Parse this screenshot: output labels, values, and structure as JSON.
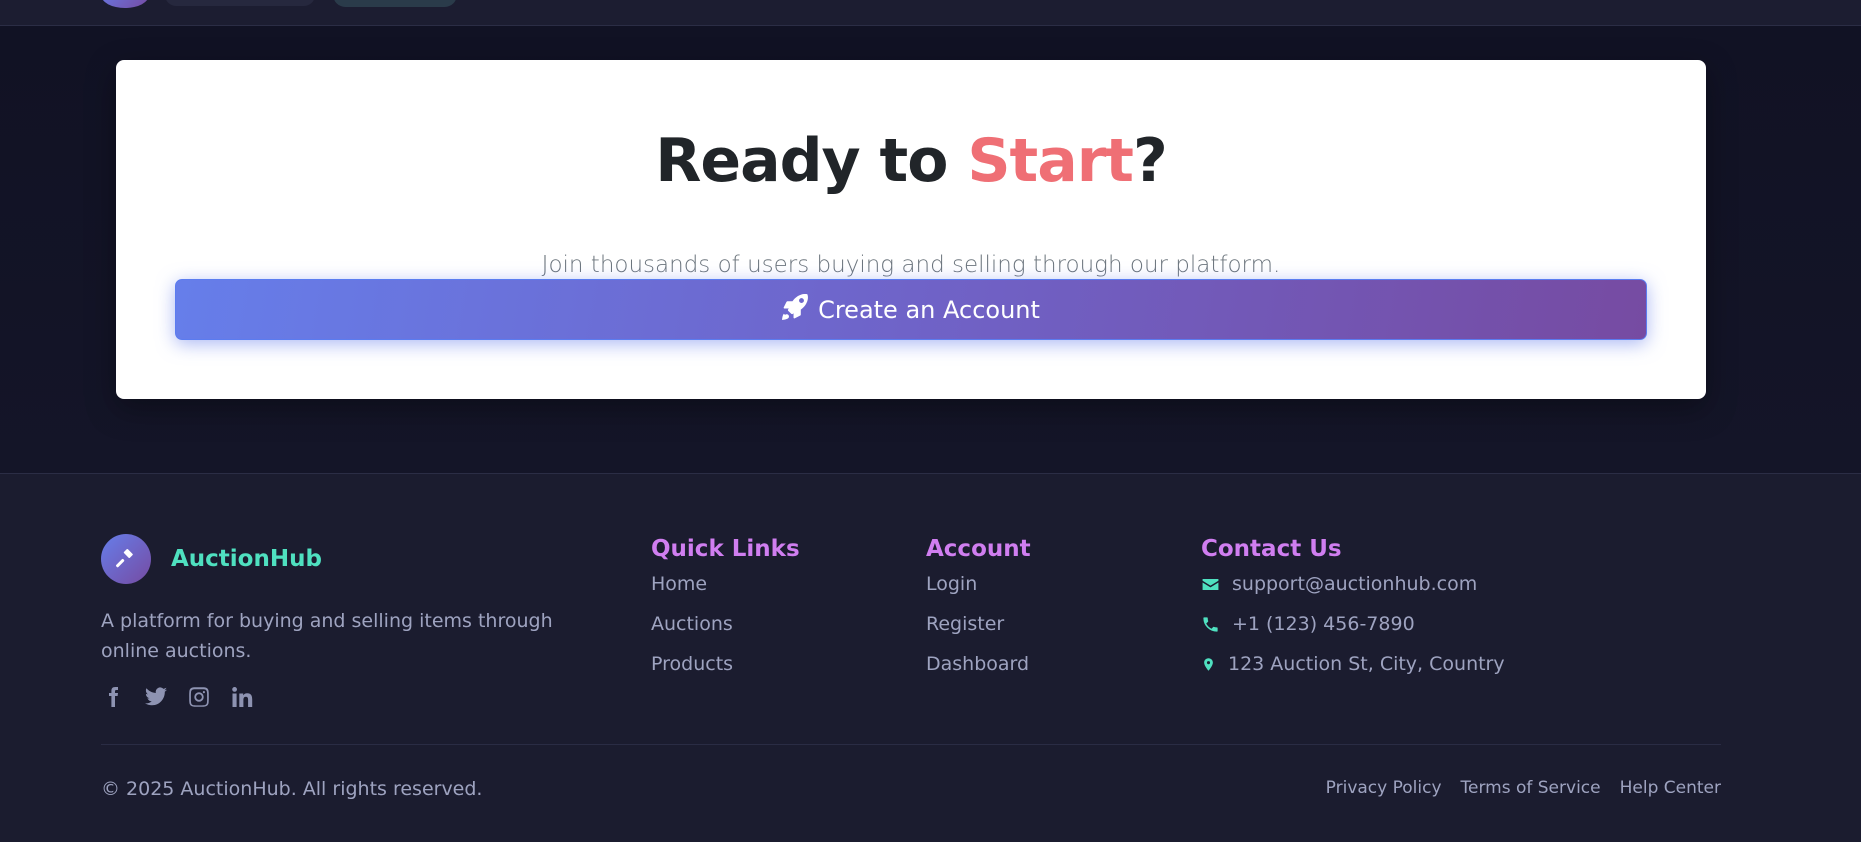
{
  "cta": {
    "title_prefix": "Ready to ",
    "title_highlight": "Start",
    "title_suffix": "?",
    "subtitle": "Join thousands of users buying and selling through our platform.",
    "button_label": "Create an Account",
    "button_icon": "rocket-icon"
  },
  "footer": {
    "brand": {
      "name": "AuctionHub",
      "logo_icon": "gavel-icon",
      "description": "A platform for buying and selling items through online auctions."
    },
    "socials": [
      "facebook-icon",
      "twitter-icon",
      "instagram-icon",
      "linkedin-icon"
    ],
    "quick_links": {
      "title": "Quick Links",
      "items": [
        "Home",
        "Auctions",
        "Products"
      ]
    },
    "account": {
      "title": "Account",
      "items": [
        "Login",
        "Register",
        "Dashboard"
      ]
    },
    "contact": {
      "title": "Contact Us",
      "email": "support@auctionhub.com",
      "phone": "+1 (123) 456-7890",
      "address": "123 Auction St, City, Country"
    },
    "copyright": "© 2025 AuctionHub. All rights reserved.",
    "legal_links": [
      "Privacy Policy",
      "Terms of Service",
      "Help Center"
    ]
  },
  "colors": {
    "accent_gradient_start": "#667eea",
    "accent_gradient_end": "#764ba2",
    "highlight": "#ef6f75",
    "footer_heading": "#d07ef0",
    "brand_teal": "#4fe0c0",
    "footer_bg": "#1b1c2f"
  }
}
